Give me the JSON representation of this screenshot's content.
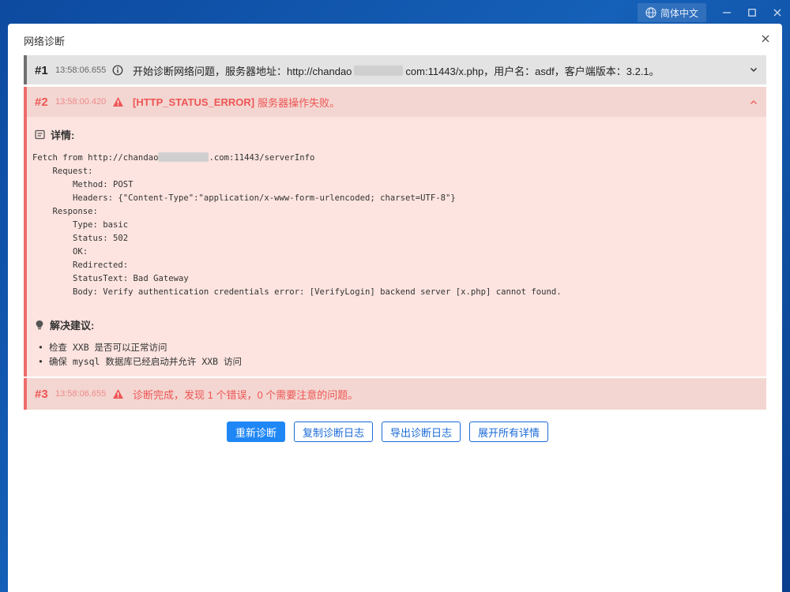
{
  "window": {
    "language_label": "简体中文",
    "language_icon": "globe-icon",
    "minimize_icon": "minimize-icon",
    "maximize_icon": "maximize-icon",
    "close_icon": "close-icon"
  },
  "dialog": {
    "title": "网络诊断",
    "close_icon": "close-icon"
  },
  "entries": [
    {
      "num": "#1",
      "time": "13:58:06.655",
      "level_icon": "info-circle-icon",
      "msg_prefix": "开始诊断网络问题，服务器地址：http://chandao",
      "msg_suffix": "com:11443/x.php，用户名：asdf，客户端版本：3.2.1。",
      "expand_icon": "chevron-down-icon"
    },
    {
      "num": "#2",
      "time": "13:58:00.420",
      "level_icon": "warning-triangle-icon",
      "code": "[HTTP_STATUS_ERROR]",
      "message": "服务器操作失败。",
      "expand_icon": "chevron-up-icon",
      "details_title": "详情:",
      "details_icon": "document-icon",
      "fetch_prefix": "Fetch from http://chandao",
      "fetch_suffix": ".com:11443/serverInfo",
      "details_lines": [
        "    Request:",
        "        Method: POST",
        "        Headers: {\"Content-Type\":\"application/x-www-form-urlencoded; charset=UTF-8\"}",
        "    Response:",
        "        Type: basic",
        "        Status: 502",
        "        OK:",
        "        Redirected:",
        "        StatusText: Bad Gateway",
        "        Body: Verify authentication credentials error: [VerifyLogin] backend server [x.php] cannot found."
      ],
      "suggestions_title": "解决建议:",
      "suggestions_icon": "lightbulb-icon",
      "suggestions": [
        "检查 XXB 是否可以正常访问",
        "确保 mysql 数据库已经启动并允许 XXB 访问"
      ]
    },
    {
      "num": "#3",
      "time": "13:58:06.655",
      "level_icon": "warning-triangle-icon",
      "message": "诊断完成，发现 1 个错误，0 个需要注意的问题。"
    }
  ],
  "buttons": {
    "rediagnose": "重新诊断",
    "copy_log": "复制诊断日志",
    "export_log": "导出诊断日志",
    "expand_all": "展开所有详情"
  },
  "colors": {
    "accent": "#1f87f5",
    "error": "#ee5555",
    "error_bg": "#fde4e0",
    "info_bg": "#e3e3e3"
  }
}
